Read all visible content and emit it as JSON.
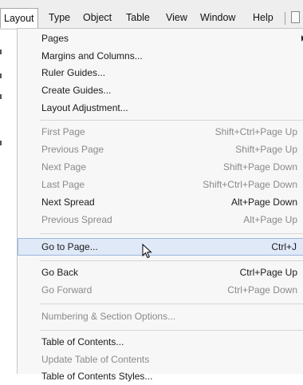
{
  "menubar": {
    "items": [
      "Layout",
      "Type",
      "Object",
      "Table",
      "View",
      "Window",
      "Help"
    ]
  },
  "menu": {
    "pages": "Pages",
    "margins": "Margins and Columns...",
    "ruler_guides": "Ruler Guides...",
    "create_guides": "Create Guides...",
    "layout_adjustment": "Layout Adjustment...",
    "first_page": {
      "label": "First Page",
      "shortcut": "Shift+Ctrl+Page Up"
    },
    "previous_page": {
      "label": "Previous Page",
      "shortcut": "Shift+Page Up"
    },
    "next_page": {
      "label": "Next Page",
      "shortcut": "Shift+Page Down"
    },
    "last_page": {
      "label": "Last Page",
      "shortcut": "Shift+Ctrl+Page Down"
    },
    "next_spread": {
      "label": "Next Spread",
      "shortcut": "Alt+Page Down"
    },
    "previous_spread": {
      "label": "Previous Spread",
      "shortcut": "Alt+Page Up"
    },
    "go_to_page": {
      "label": "Go to Page...",
      "shortcut": "Ctrl+J"
    },
    "go_back": {
      "label": "Go Back",
      "shortcut": "Ctrl+Page Up"
    },
    "go_forward": {
      "label": "Go Forward",
      "shortcut": "Ctrl+Page Down"
    },
    "numbering": "Numbering & Section Options...",
    "toc": "Table of Contents...",
    "update_toc": "Update Table of Contents",
    "toc_styles": "Table of Contents Styles..."
  },
  "colors": {
    "highlight_bg": "#dfe9f8",
    "highlight_border": "#9eb6de",
    "disabled_text": "#8a8a8a"
  }
}
